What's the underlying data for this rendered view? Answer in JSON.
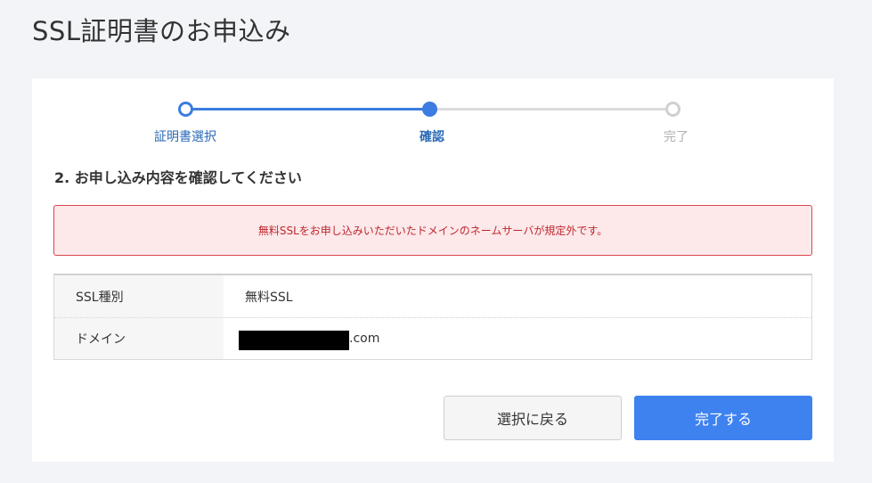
{
  "page": {
    "title": "SSL証明書のお申込み"
  },
  "stepper": {
    "steps": [
      {
        "label": "証明書選択",
        "state": "done"
      },
      {
        "label": "確認",
        "state": "current"
      },
      {
        "label": "完了",
        "state": "todo"
      }
    ]
  },
  "section": {
    "heading": "2. お申し込み内容を確認してください"
  },
  "alert": {
    "message": "無料SSLをお申し込みいただいたドメインのネームサーバが規定外です。"
  },
  "details": {
    "rows": [
      {
        "key": "SSL種別",
        "value": "無料SSL"
      },
      {
        "key": "ドメイン",
        "value_suffix": ".com"
      }
    ]
  },
  "actions": {
    "back_label": "選択に戻る",
    "complete_label": "完了する"
  },
  "colors": {
    "accent": "#3b7de1",
    "button_primary": "#3e82f0",
    "alert_border": "#d9464f",
    "alert_bg": "#fde8ea",
    "alert_text": "#c0272d"
  }
}
